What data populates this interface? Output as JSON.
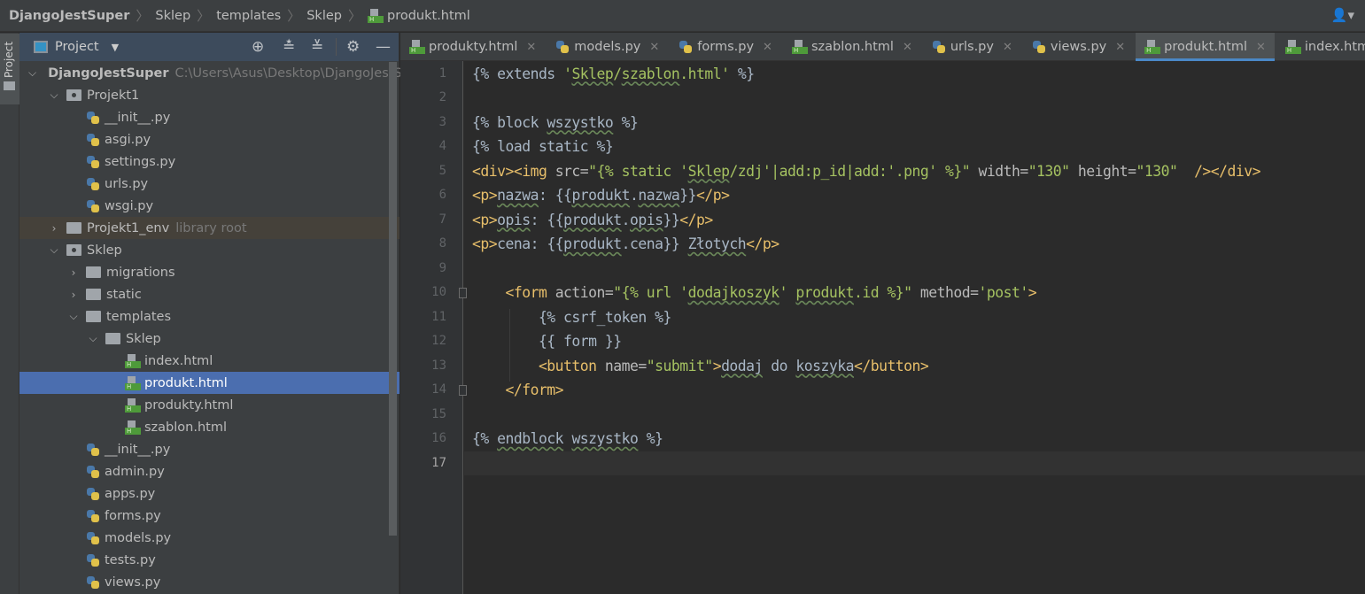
{
  "breadcrumb": [
    "DjangoJestSuper",
    "Sklep",
    "templates",
    "Sklep",
    "produkt.html"
  ],
  "project_panel": {
    "title": "Project",
    "tools": [
      "locate-icon",
      "expand-all-icon",
      "collapse-all-icon",
      "gear-icon",
      "hide-icon"
    ]
  },
  "stripe": {
    "label": "Project"
  },
  "tree": [
    {
      "level": 0,
      "type": "folder",
      "open": true,
      "label": "DjangoJestSuper",
      "bold": true,
      "hint": "C:\\Users\\Asus\\Desktop\\DjangoJestSup"
    },
    {
      "level": 1,
      "type": "module",
      "open": true,
      "label": "Projekt1"
    },
    {
      "level": 2,
      "type": "py",
      "label": "__init__.py"
    },
    {
      "level": 2,
      "type": "py",
      "label": "asgi.py"
    },
    {
      "level": 2,
      "type": "py",
      "label": "settings.py"
    },
    {
      "level": 2,
      "type": "py",
      "label": "urls.py"
    },
    {
      "level": 2,
      "type": "py",
      "label": "wsgi.py"
    },
    {
      "level": 1,
      "type": "folder",
      "open": false,
      "label": "Projekt1_env",
      "hint": "library root",
      "lib": true
    },
    {
      "level": 1,
      "type": "module",
      "open": true,
      "label": "Sklep"
    },
    {
      "level": 2,
      "type": "folder",
      "open": false,
      "label": "migrations"
    },
    {
      "level": 2,
      "type": "folder",
      "open": false,
      "label": "static"
    },
    {
      "level": 2,
      "type": "folder",
      "open": true,
      "label": "templates"
    },
    {
      "level": 3,
      "type": "folder",
      "open": true,
      "label": "Sklep"
    },
    {
      "level": 4,
      "type": "html",
      "label": "index.html"
    },
    {
      "level": 4,
      "type": "html",
      "label": "produkt.html",
      "selected": true
    },
    {
      "level": 4,
      "type": "html",
      "label": "produkty.html"
    },
    {
      "level": 4,
      "type": "html",
      "label": "szablon.html"
    },
    {
      "level": 2,
      "type": "py",
      "label": "__init__.py"
    },
    {
      "level": 2,
      "type": "py",
      "label": "admin.py"
    },
    {
      "level": 2,
      "type": "py",
      "label": "apps.py"
    },
    {
      "level": 2,
      "type": "py",
      "label": "forms.py"
    },
    {
      "level": 2,
      "type": "py",
      "label": "models.py"
    },
    {
      "level": 2,
      "type": "py",
      "label": "tests.py"
    },
    {
      "level": 2,
      "type": "py",
      "label": "views.py"
    }
  ],
  "tabs": [
    {
      "label": "produkty.html",
      "type": "html"
    },
    {
      "label": "models.py",
      "type": "py"
    },
    {
      "label": "forms.py",
      "type": "py"
    },
    {
      "label": "szablon.html",
      "type": "html"
    },
    {
      "label": "urls.py",
      "type": "py"
    },
    {
      "label": "views.py",
      "type": "py"
    },
    {
      "label": "produkt.html",
      "type": "html",
      "active": true
    },
    {
      "label": "index.html",
      "type": "html"
    }
  ],
  "editor": {
    "current_line": 17,
    "lines": [
      [
        [
          "{% extends ",
          "tpl"
        ],
        [
          "'",
          "str"
        ],
        [
          "Sklep",
          "str sp"
        ],
        [
          "/",
          "str"
        ],
        [
          "szablon",
          "str sp"
        ],
        [
          ".html'",
          "str"
        ],
        [
          " %}",
          "tpl"
        ]
      ],
      [],
      [
        [
          "{% block ",
          "tpl"
        ],
        [
          "wszystko",
          "tpl sp"
        ],
        [
          " %}",
          "tpl"
        ]
      ],
      [
        [
          "{% load static %}",
          "tpl"
        ]
      ],
      [
        [
          "<div><img ",
          "tag"
        ],
        [
          "src=",
          "attr"
        ],
        [
          "\"{% static '",
          "str"
        ],
        [
          "Sklep",
          "str sp"
        ],
        [
          "/zdj'|add:p_id|add:'.png' %}\"",
          "str"
        ],
        [
          " width=",
          "attr"
        ],
        [
          "\"130\"",
          "str"
        ],
        [
          " height=",
          "attr"
        ],
        [
          "\"130\"",
          "str"
        ],
        [
          "  /></div>",
          "tag"
        ]
      ],
      [
        [
          "<p>",
          "tag"
        ],
        [
          "nazwa",
          "text sp"
        ],
        [
          ": {{",
          "text"
        ],
        [
          "produkt",
          "text sp"
        ],
        [
          ".",
          "text"
        ],
        [
          "nazwa",
          "text sp"
        ],
        [
          "}}",
          "text"
        ],
        [
          "</p>",
          "tag"
        ]
      ],
      [
        [
          "<p>",
          "tag"
        ],
        [
          "opis",
          "text sp"
        ],
        [
          ": {{",
          "text"
        ],
        [
          "produkt",
          "text sp"
        ],
        [
          ".",
          "text"
        ],
        [
          "opis",
          "text sp"
        ],
        [
          "}}",
          "text"
        ],
        [
          "</p>",
          "tag"
        ]
      ],
      [
        [
          "<p>",
          "tag"
        ],
        [
          "cena: {{",
          "text"
        ],
        [
          "produkt",
          "text sp"
        ],
        [
          ".cena}} ",
          "text"
        ],
        [
          "Złotych",
          "text sp"
        ],
        [
          "</p>",
          "tag"
        ]
      ],
      [],
      [
        [
          "    <form ",
          "tag"
        ],
        [
          "action=",
          "attr"
        ],
        [
          "\"{% url '",
          "str"
        ],
        [
          "dodajkoszyk",
          "str sp"
        ],
        [
          "' ",
          "str"
        ],
        [
          "produkt",
          "str sp"
        ],
        [
          ".id %}\"",
          "str"
        ],
        [
          " method=",
          "attr"
        ],
        [
          "'post'",
          "str"
        ],
        [
          ">",
          "tag"
        ]
      ],
      [
        [
          "        {% csrf_token %}",
          "tpl"
        ]
      ],
      [
        [
          "        {{ form }}",
          "tpl"
        ]
      ],
      [
        [
          "        <button ",
          "tag"
        ],
        [
          "name=",
          "attr"
        ],
        [
          "\"submit\"",
          "str"
        ],
        [
          ">",
          "tag"
        ],
        [
          "dodaj",
          "text sp"
        ],
        [
          " do ",
          "text"
        ],
        [
          "koszyka",
          "text sp"
        ],
        [
          "</button>",
          "tag"
        ]
      ],
      [
        [
          "    </form>",
          "tag"
        ]
      ],
      [],
      [
        [
          "{% ",
          "tpl"
        ],
        [
          "endblock",
          "tpl sp"
        ],
        [
          " ",
          "tpl"
        ],
        [
          "wszystko",
          "tpl sp"
        ],
        [
          " %}",
          "tpl"
        ]
      ],
      []
    ]
  },
  "colors": {
    "tag": "#e8bf6a",
    "attr": "#bababa",
    "string": "#a5c261",
    "text": "#a9b7c6",
    "selection": "#4b6eaf",
    "tab_underline": "#4a88c7"
  }
}
